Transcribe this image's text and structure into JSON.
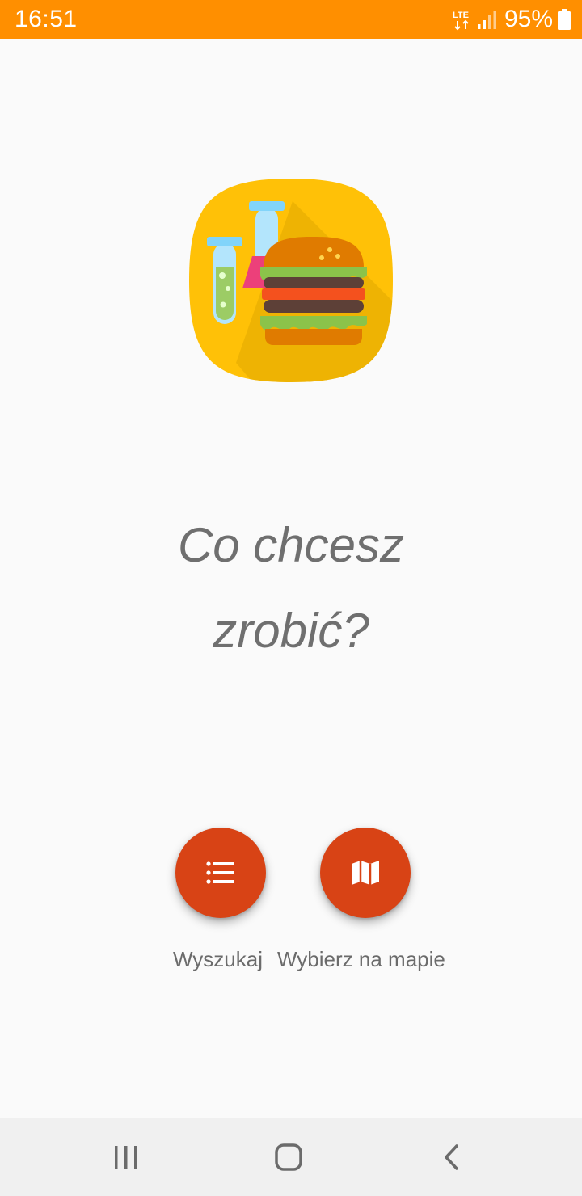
{
  "status_bar": {
    "time": "16:51",
    "network": "LTE",
    "battery": "95%",
    "background": "#ff8f00"
  },
  "app_logo": {
    "icon": "burger-lab-icon"
  },
  "headline": {
    "line1": "Co chcesz",
    "line2": "zrobić?"
  },
  "actions": {
    "search": {
      "label": "Wyszukaj",
      "icon": "list-icon"
    },
    "map": {
      "label": "Wybierz na mapie",
      "icon": "map-icon"
    },
    "accent_color": "#d84315"
  },
  "nav_bar": {
    "recents_icon": "recents-icon",
    "home_icon": "home-icon",
    "back_icon": "back-icon"
  }
}
